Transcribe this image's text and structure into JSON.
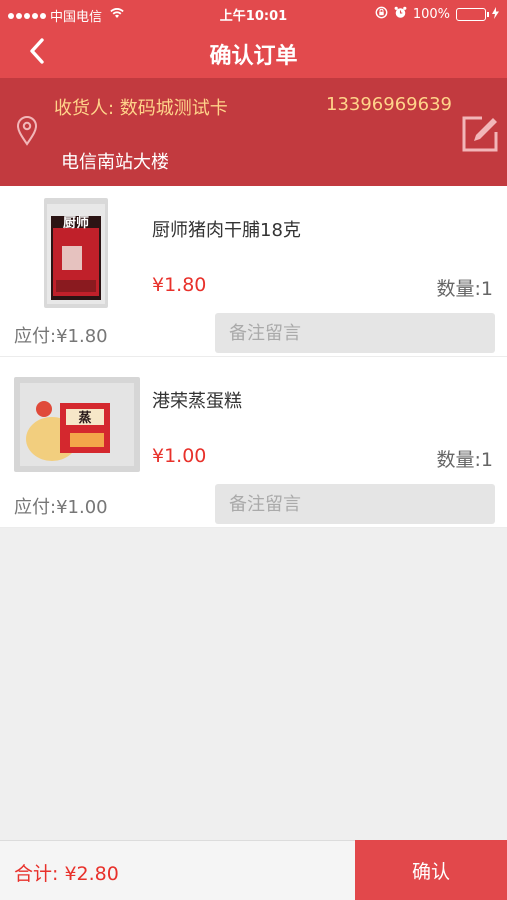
{
  "status_bar": {
    "carrier": "中国电信",
    "time": "上午10:01",
    "battery": "100%",
    "battery_level": 1.0
  },
  "nav": {
    "title": "确认订单",
    "back_icon": "chevron-left-icon"
  },
  "address": {
    "receiver_label": "收货人: 数码城测试卡",
    "phone": "13396969639",
    "address": "电信南站大楼",
    "location_icon": "location-pin-icon",
    "edit_icon": "edit-icon"
  },
  "items": [
    {
      "name": "厨师猪肉干脯18克",
      "price": "¥1.80",
      "quantity": "数量:1",
      "payable": "应付:¥1.80",
      "remark_placeholder": "备注留言",
      "thumb_text": "厨师"
    },
    {
      "name": "港荣蒸蛋糕",
      "price": "¥1.00",
      "quantity": "数量:1",
      "payable": "应付:¥1.00",
      "remark_placeholder": "备注留言",
      "thumb_text": "蒸"
    }
  ],
  "footer": {
    "total": "合计: ¥2.80",
    "confirm_label": "确认"
  },
  "colors": {
    "nav_red": "#e24a4d",
    "address_red": "#c23a3f",
    "price_red": "#e8312b",
    "receiver_yellow": "#ffd48a"
  }
}
